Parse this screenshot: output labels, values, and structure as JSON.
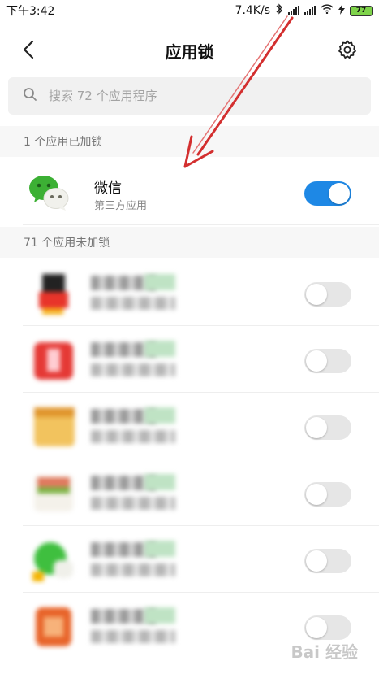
{
  "status_bar": {
    "time": "下午3:42",
    "net_speed": "7.4K/s",
    "battery": "77"
  },
  "header": {
    "title": "应用锁",
    "back_icon": "chevron-left-icon",
    "settings_icon": "gear-icon"
  },
  "search": {
    "placeholder": "搜索 72 个应用程序",
    "icon": "search-icon"
  },
  "locked_section": {
    "title": "1 个应用已加锁",
    "apps": [
      {
        "name": "微信",
        "subtitle": "第三方应用",
        "locked": true,
        "icon": "wechat-icon"
      }
    ]
  },
  "unlocked_section": {
    "title": "71 个应用未加锁",
    "apps_blurred": [
      {
        "icon_color": "#c0392b",
        "locked": false
      },
      {
        "icon_color": "#e53935",
        "locked": false
      },
      {
        "icon_color": "#f2c35e",
        "locked": false
      },
      {
        "icon_color": "#e07a5f",
        "locked": false
      },
      {
        "icon_color": "#3fbf3f",
        "locked": false
      },
      {
        "icon_color": "#e8642a",
        "locked": false
      }
    ]
  },
  "watermark": "Bai 经验",
  "colors": {
    "toggle_on": "#1e88e5",
    "toggle_off": "#e6e6e6",
    "annotation_arrow": "#d32f2f"
  }
}
